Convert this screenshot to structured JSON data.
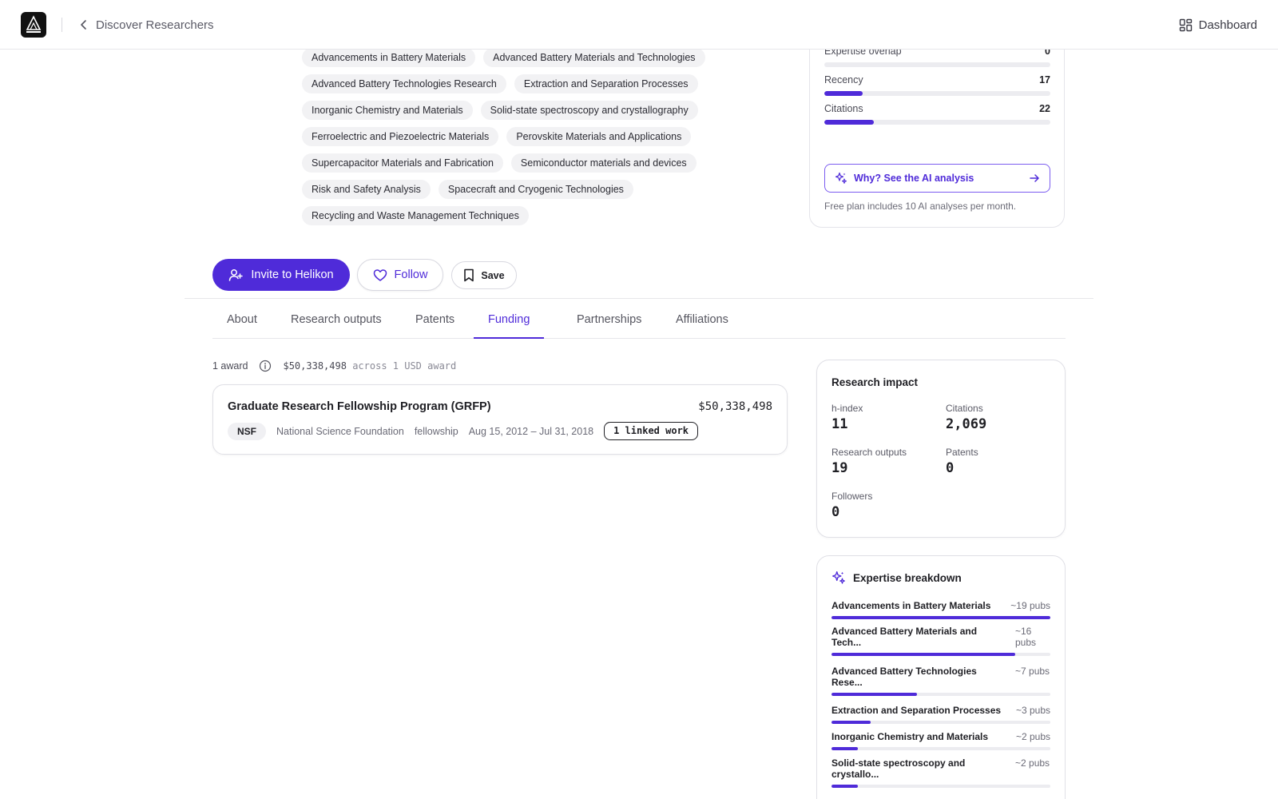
{
  "topbar": {
    "back_label": "Discover Researchers",
    "dashboard_label": "Dashboard",
    "logo_text": "HELIKON LABS"
  },
  "expertise_tags": [
    "Advancements in Battery Materials",
    "Advanced Battery Materials and Technologies",
    "Advanced Battery Technologies Research",
    "Extraction and Separation Processes",
    "Inorganic Chemistry and Materials",
    "Solid-state spectroscopy and crystallography",
    "Ferroelectric and Piezoelectric Materials",
    "Perovskite Materials and Applications",
    "Supercapacitor Materials and Fabrication",
    "Semiconductor materials and devices",
    "Risk and Safety Analysis",
    "Spacecraft and Cryogenic Technologies",
    "Recycling and Waste Management Techniques"
  ],
  "match_card": {
    "metrics": [
      {
        "label": "",
        "value": "",
        "fill": 0.71
      },
      {
        "label": "Expertise overlap",
        "value": "0",
        "fill": 0
      },
      {
        "label": "Recency",
        "value": "17",
        "fill": 0.17
      },
      {
        "label": "Citations",
        "value": "22",
        "fill": 0.22
      }
    ],
    "ai_button_label": "Why? See the AI analysis",
    "free_note": "Free plan includes 10 AI analyses per month."
  },
  "actions": {
    "invite_label": "Invite to Helikon",
    "follow_label": "Follow",
    "save_label": "Save"
  },
  "tabs": [
    "About",
    "Research outputs",
    "Patents",
    "Funding",
    "Partnerships",
    "Affiliations"
  ],
  "active_tab": "Funding",
  "funding": {
    "count_label": "1 award",
    "total": "$50,338,498",
    "total_suffix": "across 1 USD award",
    "awards": [
      {
        "title": "Graduate Research Fellowship Program (GRFP)",
        "amount": "$50,338,498",
        "funder_code": "NSF",
        "funder_name": "National Science Foundation",
        "type": "fellowship",
        "dates": "Aug 15, 2012 – Jul 31, 2018",
        "linked": "1 linked work"
      }
    ]
  },
  "impact": {
    "title": "Research impact",
    "h_index_label": "h-index",
    "h_index": "11",
    "citations_label": "Citations",
    "citations": "2,069",
    "outputs_label": "Research outputs",
    "outputs": "19",
    "patents_label": "Patents",
    "patents": "0",
    "followers_label": "Followers",
    "followers": "0"
  },
  "breakdown": {
    "title": "Expertise breakdown",
    "items": [
      {
        "name": "Advancements in Battery Materials",
        "count": "~19 pubs",
        "fill": 1.0
      },
      {
        "name": "Advanced Battery Materials and Tech...",
        "count": "~16 pubs",
        "fill": 0.84
      },
      {
        "name": "Advanced Battery Technologies Rese...",
        "count": "~7 pubs",
        "fill": 0.39
      },
      {
        "name": "Extraction and Separation Processes",
        "count": "~3 pubs",
        "fill": 0.18
      },
      {
        "name": "Inorganic Chemistry and Materials",
        "count": "~2 pubs",
        "fill": 0.12
      },
      {
        "name": "Solid-state spectroscopy and crystallo...",
        "count": "~2 pubs",
        "fill": 0.12
      }
    ]
  },
  "colors": {
    "accent": "#4f2bd9",
    "track": "#ececf0",
    "chip_bg": "#f2f2f4"
  }
}
